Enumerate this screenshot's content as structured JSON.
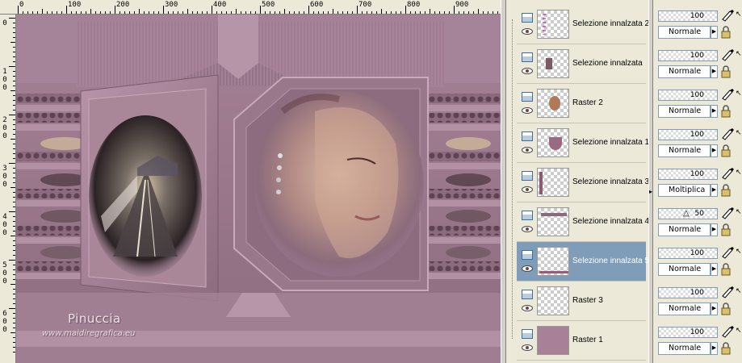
{
  "ruler": {
    "top_labels": [
      "0",
      "100",
      "200",
      "300",
      "400",
      "500",
      "600",
      "700",
      "800",
      "900"
    ],
    "left_labels": [
      [
        "0"
      ],
      [
        "1",
        "0",
        "0"
      ],
      [
        "2",
        "0",
        "0"
      ],
      [
        "3",
        "0",
        "0"
      ],
      [
        "4",
        "0",
        "0"
      ],
      [
        "5",
        "0",
        "0"
      ],
      [
        "6",
        "0",
        "0"
      ]
    ]
  },
  "canvas": {
    "signature": "Pinuccia",
    "website": "www.maidiregrafica.eu",
    "colors": {
      "mauve": "#9c7a8c",
      "mauve_light": "#c4a4b6",
      "mauve_dark": "#6b4e5e"
    }
  },
  "layers": [
    {
      "name": "Selezione innalzata 2",
      "opacity": "100",
      "blend": "Normale",
      "selected": false,
      "thumb": "bars-icon"
    },
    {
      "name": "Selezione innalzata",
      "opacity": "100",
      "blend": "Normale",
      "selected": false,
      "thumb": "figure-icon"
    },
    {
      "name": "Raster 2",
      "opacity": "100",
      "blend": "Normale",
      "selected": false,
      "thumb": "portrait-icon"
    },
    {
      "name": "Selezione innalzata 1",
      "opacity": "100",
      "blend": "Normale",
      "selected": false,
      "thumb": "shape-icon"
    },
    {
      "name": "Selezione innalzata 3",
      "opacity": "100",
      "blend": "Moltiplica",
      "selected": false,
      "thumb": "strip-icon"
    },
    {
      "name": "Selezione innalzata 4",
      "opacity": "50",
      "blend": "Normale",
      "selected": false,
      "thumb": "frame-icon"
    },
    {
      "name": "Selezione innalzata 5",
      "opacity": "100",
      "blend": "Normale",
      "selected": true,
      "thumb": "base-strip-icon"
    },
    {
      "name": "Raster 3",
      "opacity": "100",
      "blend": "Normale",
      "selected": false,
      "thumb": "empty-icon"
    },
    {
      "name": "Raster 1",
      "opacity": "100",
      "blend": "Normale",
      "selected": false,
      "thumb": "background-icon"
    }
  ]
}
